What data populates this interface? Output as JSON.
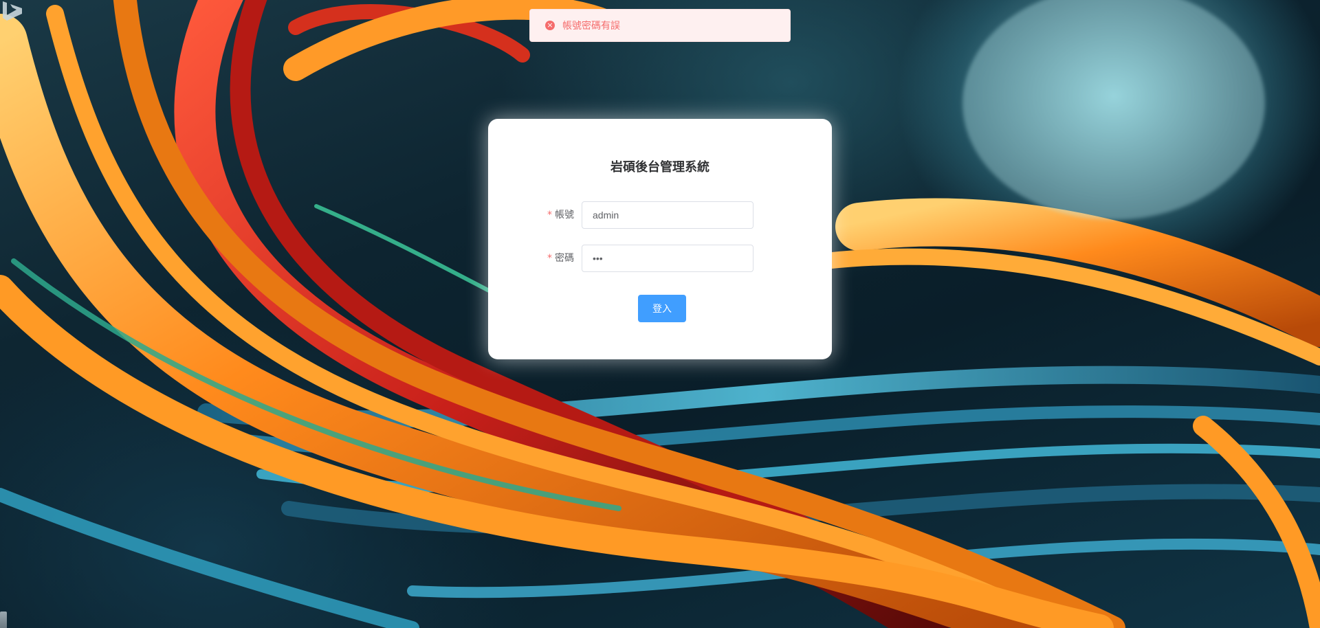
{
  "message": {
    "text": "帳號密碼有誤",
    "icon": "error-circle-icon",
    "icon_glyph": "×",
    "color": "#f56c6c",
    "background": "#fef0f0"
  },
  "login_form": {
    "title": "岩碩後台管理系統",
    "account": {
      "required_mark": "*",
      "label": "帳號",
      "value": "admin"
    },
    "password": {
      "required_mark": "*",
      "label": "密碼",
      "value": "abc"
    },
    "submit_label": "登入",
    "accent_color": "#409eff"
  },
  "background": {
    "description_colors": [
      "#ff8a1c",
      "#d8251a",
      "#2fa6c9",
      "#0d2430"
    ]
  }
}
